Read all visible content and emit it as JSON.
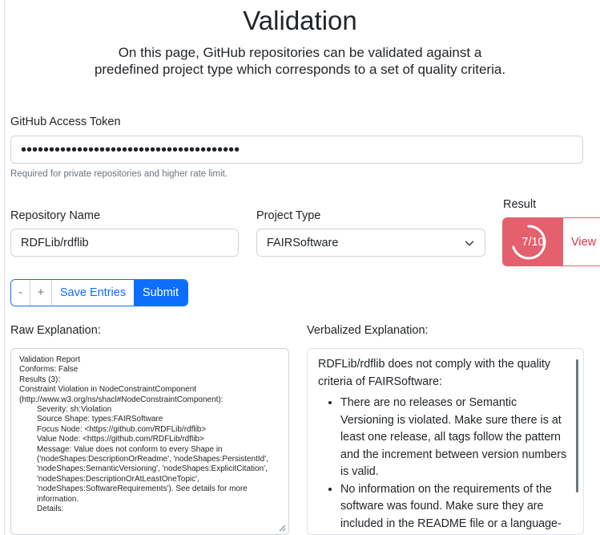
{
  "page": {
    "title": "Validation",
    "description": "On this page, GitHub repositories can be validated against a predefined project type which corresponds to a set of quality criteria."
  },
  "token": {
    "label": "GitHub Access Token",
    "value": "•••••••••••••••••••••••••••••••••••••••",
    "help": "Required for private repositories and higher rate limit."
  },
  "repository": {
    "label": "Repository Name",
    "value": "RDFLib/rdflib"
  },
  "project_type": {
    "label": "Project Type",
    "selected": "FAIRSoftware"
  },
  "result": {
    "label": "Result",
    "score": "7/10",
    "score_fraction": 0.7,
    "view_label": "View",
    "color": "#e4606d"
  },
  "actions": {
    "minus": "-",
    "plus": "+",
    "save": "Save Entries",
    "submit": "Submit"
  },
  "raw_explanation": {
    "label": "Raw Explanation:",
    "lines": [
      "Validation Report",
      "Conforms: False",
      "Results (3):",
      "Constraint Violation in NodeConstraintComponent (http://www.w3.org/ns/shacl#NodeConstraintComponent):",
      "Severity: sh:Violation",
      "Source Shape: types:FAIRSoftware",
      "Focus Node: <https://github.com/RDFLib/rdflib>",
      "Value Node: <https://github.com/RDFLib/rdflib>",
      "Message: Value does not conform to every Shape in ('nodeShapes:DescriptionOrReadme', 'nodeShapes:PersistentId', 'nodeShapes:SemanticVersioning', 'nodeShapes:ExplicitCitation', 'nodeShapes:DescriptionOrAtLeastOneTopic', 'nodeShapes:SoftwareRequirements'). See details for more information.",
      "Details:"
    ]
  },
  "verbalized_explanation": {
    "label": "Verbalized Explanation:",
    "intro": "RDFLib/rdflib does not comply with the quality criteria of FAIRSoftware:",
    "items": [
      "There are no releases or Semantic Versioning is violated. Make sure there is at least one release, all tags follow the pattern and the increment between version numbers is valid.",
      "No information on the requirements of the software was found. Make sure they are included in the README file or a language-specific requirements file is used."
    ]
  }
}
